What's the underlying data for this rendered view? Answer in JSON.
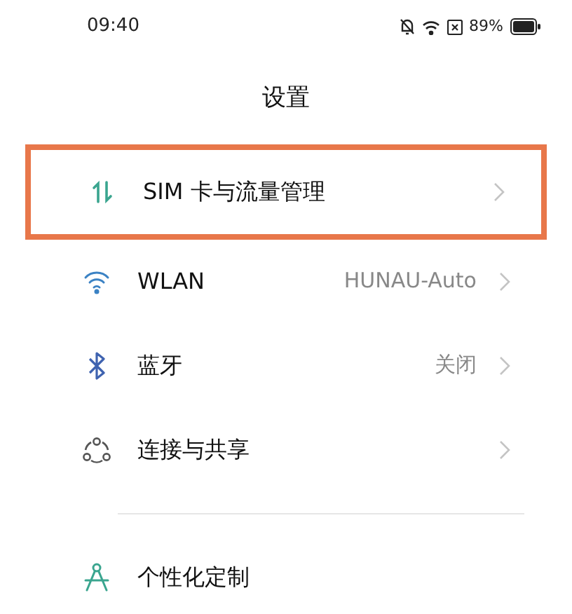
{
  "status_bar": {
    "time": "09:40",
    "battery": "89%"
  },
  "title": "设置",
  "items": [
    {
      "kind": "sim",
      "label": "SIM 卡与流量管理",
      "highlighted": true,
      "chevron": true
    },
    {
      "kind": "wifi",
      "label": "WLAN",
      "value": "HUNAU-Auto",
      "highlighted": false,
      "chevron": true
    },
    {
      "kind": "bluetooth",
      "label": "蓝牙",
      "value": "关闭",
      "highlighted": false,
      "chevron": true
    },
    {
      "kind": "share",
      "label": "连接与共享",
      "highlighted": false,
      "chevron": true
    },
    {
      "kind": "divider"
    },
    {
      "kind": "theme",
      "label": "个性化定制",
      "highlighted": false,
      "chevron": false
    }
  ]
}
